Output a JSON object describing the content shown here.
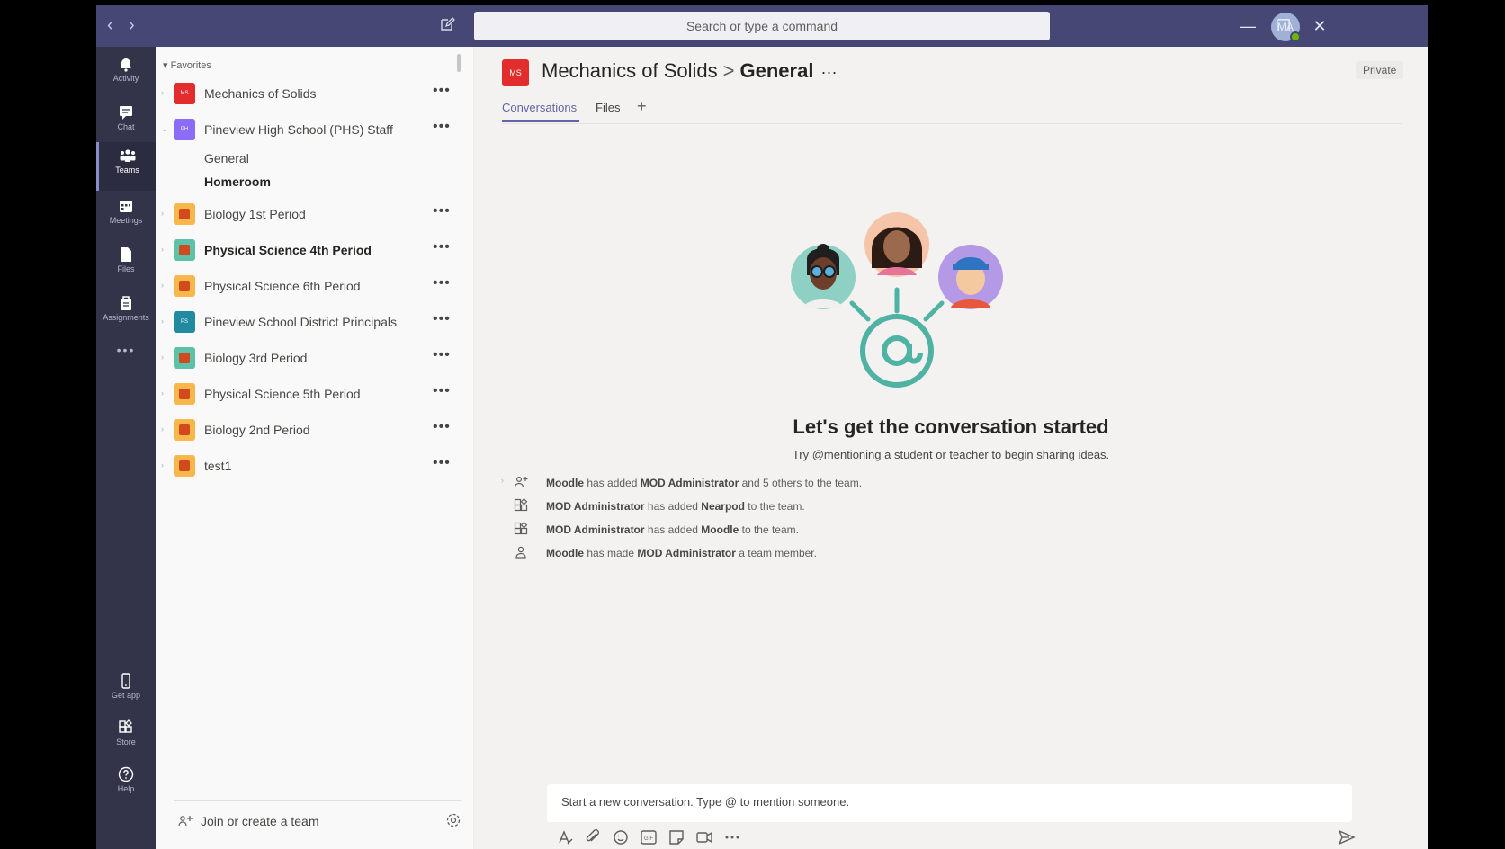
{
  "titlebar": {
    "search_placeholder": "Search or type a command",
    "avatar_initials": "MA",
    "nav_back": "‹",
    "nav_forward": "›",
    "minimize": "—",
    "restore": "❐",
    "close": "✕"
  },
  "rail": {
    "items": [
      {
        "label": "Activity",
        "icon": "bell-icon"
      },
      {
        "label": "Chat",
        "icon": "chat-icon"
      },
      {
        "label": "Teams",
        "icon": "teams-icon",
        "active": true
      },
      {
        "label": "Meetings",
        "icon": "calendar-icon"
      },
      {
        "label": "Files",
        "icon": "file-icon"
      },
      {
        "label": "Assignments",
        "icon": "assignments-icon"
      }
    ],
    "more": "•••",
    "bottom": [
      {
        "label": "Get app",
        "icon": "phone-icon"
      },
      {
        "label": "Store",
        "icon": "store-icon"
      },
      {
        "label": "Help",
        "icon": "help-icon"
      }
    ]
  },
  "teams": {
    "favorites_label": "Favorites",
    "more_glyph": "•••",
    "list": [
      {
        "name": "Mechanics of Solids",
        "avatar_text": "MS",
        "color": "#e32c2c"
      },
      {
        "name": "Pineview High School (PHS) Staff",
        "avatar_text": "PH",
        "color": "#8b6cf6",
        "channels": [
          "General",
          "Homeroom"
        ]
      },
      {
        "name": "Biology 1st Period",
        "color": "#f7b74a"
      },
      {
        "name": "Physical Science 4th Period",
        "color": "#5cc3a8",
        "bold": true
      },
      {
        "name": "Physical Science 6th Period",
        "color": "#f7b74a"
      },
      {
        "name": "Pineview School District Principals",
        "avatar_text": "PS",
        "color": "#1f8aa0"
      },
      {
        "name": "Biology 3rd Period",
        "color": "#5cc3a8"
      },
      {
        "name": "Physical Science 5th Period",
        "color": "#f7b74a"
      },
      {
        "name": "Biology 2nd Period",
        "color": "#f7b74a"
      },
      {
        "name": "test1",
        "color": "#f7b74a"
      }
    ],
    "join_label": "Join or create a team"
  },
  "channel": {
    "avatar_text": "MS",
    "team_name": "Mechanics of Solids",
    "separator": ">",
    "channel_name": "General",
    "dots": "···",
    "privacy": "Private",
    "tabs": [
      "Conversations",
      "Files"
    ],
    "tab_add": "+"
  },
  "empty_state": {
    "title": "Let's get the conversation started",
    "subtitle": "Try @mentioning a student or teacher to begin sharing ideas."
  },
  "activity": [
    {
      "icon": "person-add-icon",
      "parts": [
        "Moodle",
        " has added ",
        "MOD Administrator",
        " and 5 others to the team."
      ]
    },
    {
      "icon": "app-icon",
      "parts": [
        "MOD Administrator",
        " has added ",
        "Nearpod",
        " to the team."
      ]
    },
    {
      "icon": "app-icon",
      "parts": [
        "MOD Administrator",
        " has added ",
        "Moodle",
        " to the team."
      ]
    },
    {
      "icon": "person-icon",
      "parts": [
        "Moodle",
        " has made ",
        "MOD Administrator",
        " a team member."
      ]
    }
  ],
  "compose": {
    "placeholder": "Start a new conversation. Type @ to mention someone.",
    "tools": [
      "format-icon",
      "attach-icon",
      "emoji-icon",
      "gif-icon",
      "sticker-icon",
      "meet-icon",
      "more-icon"
    ]
  }
}
